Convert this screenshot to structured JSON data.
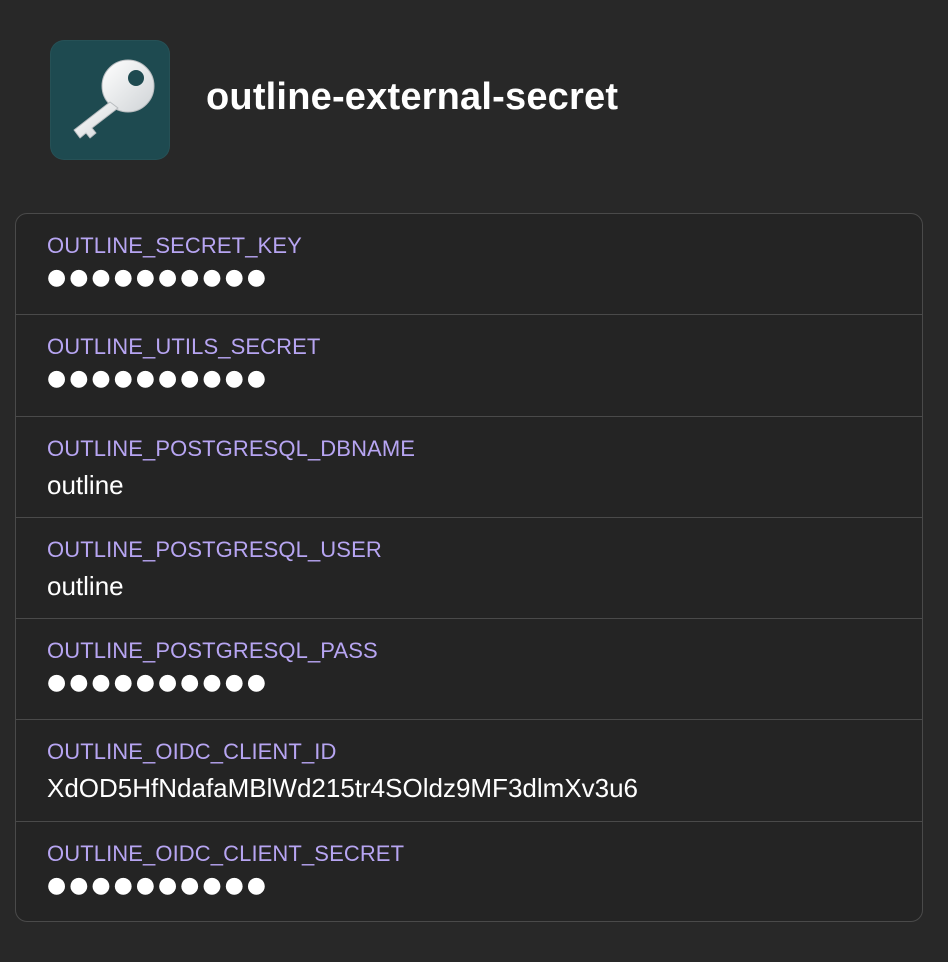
{
  "header": {
    "icon": "key-icon",
    "icon_color": "#1e4a50",
    "title": "outline-external-secret"
  },
  "colors": {
    "background": "#282828",
    "label": "#b7a5f2",
    "value": "#ffffff",
    "divider": "#4a4a4a"
  },
  "fields": [
    {
      "label": "OUTLINE_SECRET_KEY",
      "value": "●●●●●●●●●●",
      "masked": true
    },
    {
      "label": "OUTLINE_UTILS_SECRET",
      "value": "●●●●●●●●●●",
      "masked": true
    },
    {
      "label": "OUTLINE_POSTGRESQL_DBNAME",
      "value": "outline",
      "masked": false
    },
    {
      "label": "OUTLINE_POSTGRESQL_USER",
      "value": "outline",
      "masked": false
    },
    {
      "label": "OUTLINE_POSTGRESQL_PASS",
      "value": "●●●●●●●●●●",
      "masked": true
    },
    {
      "label": "OUTLINE_OIDC_CLIENT_ID",
      "value": "XdOD5HfNdafaMBlWd215tr4SOldz9MF3dlmXv3u6",
      "masked": false
    },
    {
      "label": "OUTLINE_OIDC_CLIENT_SECRET",
      "value": "●●●●●●●●●●",
      "masked": true
    }
  ]
}
